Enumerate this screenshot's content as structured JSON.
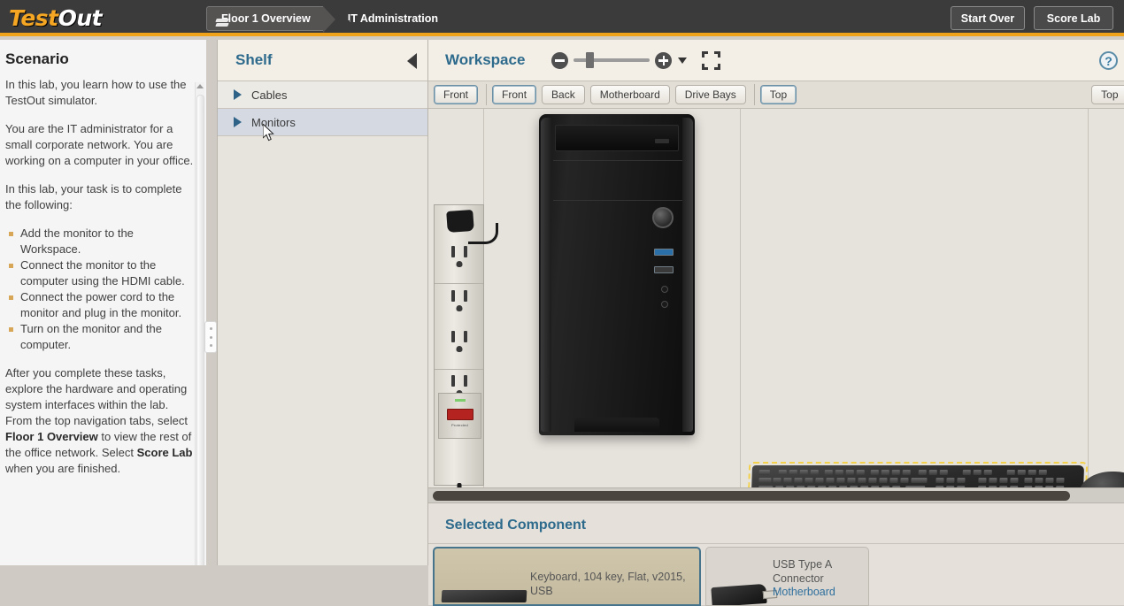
{
  "topbar": {
    "logo_test": "Test",
    "logo_out": "Out",
    "tabs": [
      {
        "label": "Floor 1 Overview",
        "icon": "layers-icon",
        "active": true
      },
      {
        "label": "IT Administration",
        "icon": "monitor-icon",
        "active": false
      }
    ],
    "start_over_label": "Start Over",
    "score_lab_label": "Score Lab"
  },
  "scenario": {
    "heading": "Scenario",
    "para1": "In this lab, you learn how to use the TestOut simulator.",
    "para2": "You are the IT administrator for a small corporate network. You are working on a computer in your office.",
    "para3": "In this lab, your task is to complete the following:",
    "tasks": [
      "Add the monitor to the Workspace.",
      "Connect the monitor to the computer using the HDMI cable.",
      "Connect the power cord to the monitor and plug in the monitor.",
      "Turn on the monitor and the computer."
    ],
    "outro_1": "After you complete these tasks, explore the hardware and operating system interfaces within the lab. From the top navigation tabs, select ",
    "outro_bold_1": "Floor 1 Overview",
    "outro_2": " to view the rest of the office network. Select ",
    "outro_bold_2": "Score Lab",
    "outro_3": " when you are finished."
  },
  "shelf": {
    "title": "Shelf",
    "collapse_icon": "chevron-left-icon",
    "items": [
      {
        "label": "Cables",
        "expanded": false,
        "hover": false
      },
      {
        "label": "Monitors",
        "expanded": false,
        "hover": true
      }
    ]
  },
  "workspace": {
    "title": "Workspace",
    "zoom_out_icon": "minus-circle-icon",
    "zoom_in_icon": "plus-circle-icon",
    "zoom_dropdown_icon": "chevron-down-icon",
    "fullscreen_icon": "fullscreen-icon",
    "help_icon": "help-icon",
    "help_label": "?",
    "tab_groups": [
      {
        "tabs": [
          {
            "label": "Front",
            "selected": true
          }
        ]
      },
      {
        "tabs": [
          {
            "label": "Front",
            "selected": true
          },
          {
            "label": "Back",
            "selected": false
          },
          {
            "label": "Motherboard",
            "selected": false
          },
          {
            "label": "Drive Bays",
            "selected": false
          }
        ]
      },
      {
        "tabs": [
          {
            "label": "Top",
            "selected": true
          }
        ]
      },
      {
        "tabs": [
          {
            "label": "Top",
            "selected": false
          }
        ]
      }
    ],
    "objects": [
      {
        "name": "power-strip",
        "selected": false
      },
      {
        "name": "computer-tower",
        "selected": false
      },
      {
        "name": "keyboard",
        "selected": true
      },
      {
        "name": "mouse",
        "selected": false
      }
    ],
    "scrollbar": "horizontal"
  },
  "selected_component": {
    "heading": "Selected Component",
    "cards": [
      {
        "text": "Keyboard, 104 key, Flat, v2015, USB",
        "link": "",
        "selected": true
      },
      {
        "text": "USB Type A Connector",
        "link": "Motherboard",
        "selected": false
      }
    ]
  },
  "colors": {
    "topbar_bg": "#3b3b3b",
    "accent_orange": "#f0a31a",
    "panel_title_blue": "#2d6a8c",
    "selection_yellow": "#f3d14a",
    "card_selected_border": "#46748d",
    "link_blue": "#2f6f9e",
    "bullet": "#d8a657"
  }
}
